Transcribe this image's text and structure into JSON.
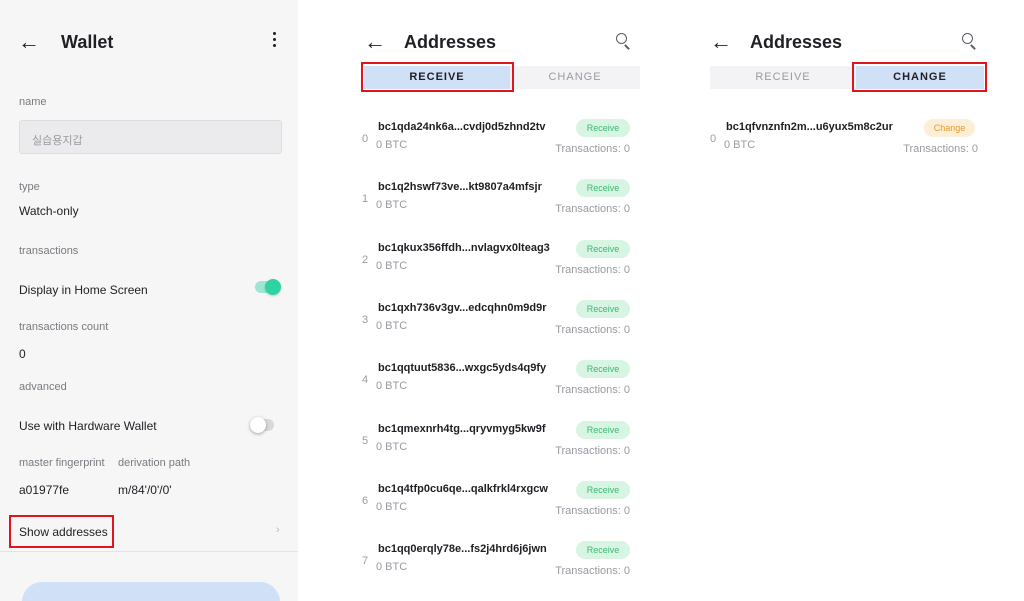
{
  "wallet_screen": {
    "title": "Wallet",
    "name_label": "name",
    "name_value": "실습용지갑",
    "type_label": "type",
    "type_value": "Watch-only",
    "transactions_label": "transactions",
    "display_home_label": "Display in Home Screen",
    "display_home_on": true,
    "tx_count_label": "transactions count",
    "tx_count_value": "0",
    "advanced_label": "advanced",
    "hw_wallet_label": "Use with Hardware Wallet",
    "hw_wallet_on": false,
    "fingerprint_label": "master fingerprint",
    "fingerprint_value": "a01977fe",
    "derivation_label": "derivation path",
    "derivation_value": "m/84'/0'/0'",
    "show_addresses_label": "Show addresses",
    "chevron": "›"
  },
  "receive_screen": {
    "title": "Addresses",
    "tab_receive": "RECEIVE",
    "tab_change": "CHANGE",
    "active_tab": "RECEIVE",
    "addresses": [
      {
        "index": "0",
        "address": "bc1qda24nk6a...cvdj0d5zhnd2tv",
        "balance": "0 BTC",
        "badge": "Receive",
        "transactions": "Transactions: 0"
      },
      {
        "index": "1",
        "address": "bc1q2hswf73ve...kt9807a4mfsjr",
        "balance": "0 BTC",
        "badge": "Receive",
        "transactions": "Transactions: 0"
      },
      {
        "index": "2",
        "address": "bc1qkux356ffdh...nvlagvx0lteag3",
        "balance": "0 BTC",
        "badge": "Receive",
        "transactions": "Transactions: 0"
      },
      {
        "index": "3",
        "address": "bc1qxh736v3gv...edcqhn0m9d9r",
        "balance": "0 BTC",
        "badge": "Receive",
        "transactions": "Transactions: 0"
      },
      {
        "index": "4",
        "address": "bc1qqtuut5836...wxgc5yds4q9fy",
        "balance": "0 BTC",
        "badge": "Receive",
        "transactions": "Transactions: 0"
      },
      {
        "index": "5",
        "address": "bc1qmexnrh4tg...qryvmyg5kw9f",
        "balance": "0 BTC",
        "badge": "Receive",
        "transactions": "Transactions: 0"
      },
      {
        "index": "6",
        "address": "bc1q4tfp0cu6qe...qalkfrkl4rxgcw",
        "balance": "0 BTC",
        "badge": "Receive",
        "transactions": "Transactions: 0"
      },
      {
        "index": "7",
        "address": "bc1qq0erqly78e...fs2j4hrd6j6jwn",
        "balance": "0 BTC",
        "badge": "Receive",
        "transactions": "Transactions: 0"
      }
    ]
  },
  "change_screen": {
    "title": "Addresses",
    "tab_receive": "RECEIVE",
    "tab_change": "CHANGE",
    "active_tab": "CHANGE",
    "addresses": [
      {
        "index": "0",
        "address": "bc1qfvnznfn2m...u6yux5m8c2ur",
        "balance": "0 BTC",
        "badge": "Change",
        "transactions": "Transactions: 0"
      }
    ]
  },
  "colors": {
    "accent_green": "#2ed3a4",
    "active_tab_bg": "#cfe0f7",
    "highlight_red": "#e0161e",
    "receive_badge_bg": "#d8f5e4",
    "receive_badge_text": "#3eb872",
    "change_badge_bg": "#fdeed6",
    "change_badge_text": "#e39a33"
  },
  "icons": [
    "back-arrow-icon",
    "kebab-menu-icon",
    "search-icon",
    "chevron-right-icon"
  ]
}
